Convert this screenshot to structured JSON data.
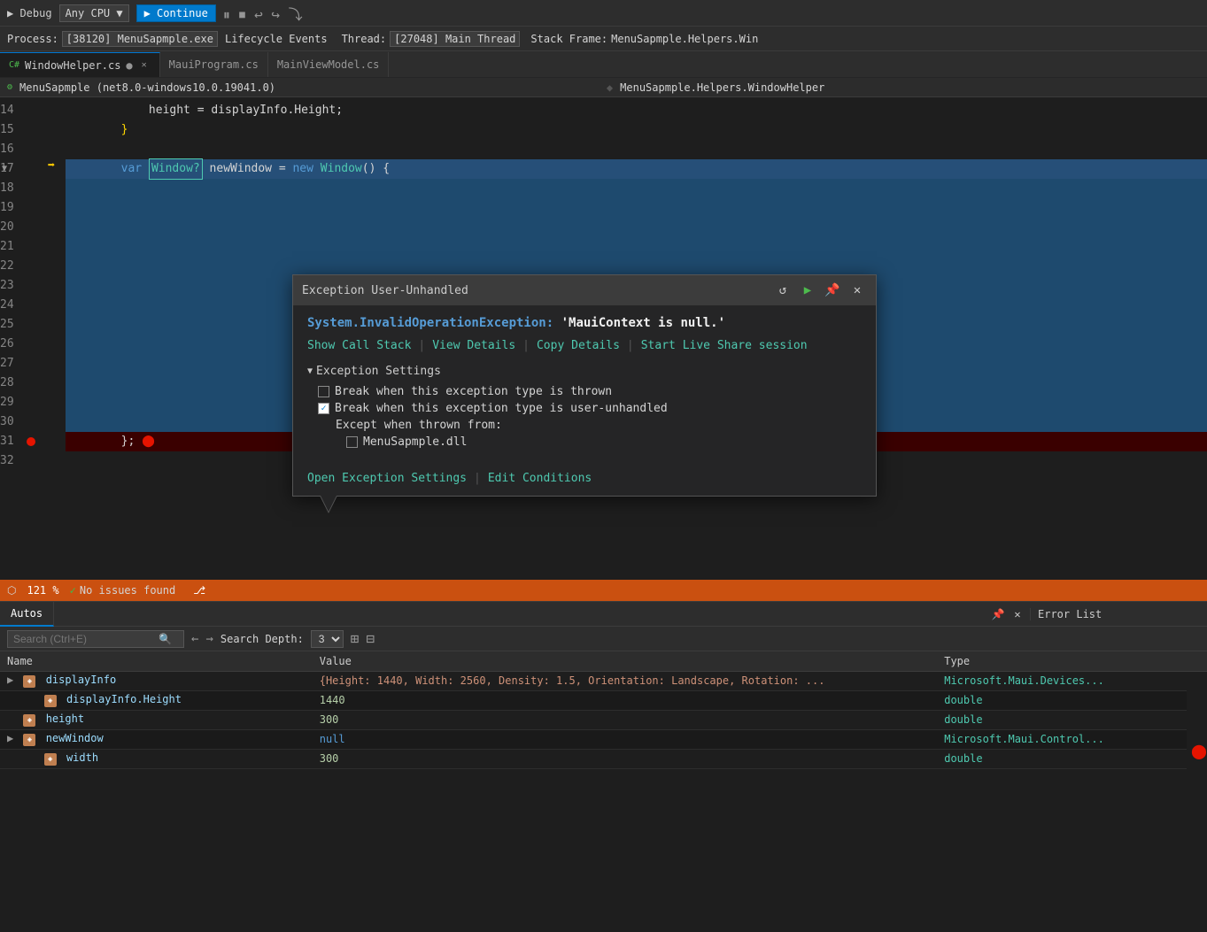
{
  "toolbar": {
    "process_label": "Process:",
    "process_value": "[38120] MenuSapmple.exe",
    "lifecycle_label": "Lifecycle Events",
    "thread_label": "Thread:",
    "thread_value": "[27048] Main Thread",
    "stackframe_label": "Stack Frame:",
    "stackframe_value": "MenuSapmple.Helpers.Win"
  },
  "tabs": [
    {
      "label": "WindowHelper.cs",
      "active": true,
      "modified": true
    },
    {
      "label": "MauiProgram.cs",
      "active": false,
      "modified": false
    },
    {
      "label": "MainViewModel.cs",
      "active": false,
      "modified": false
    }
  ],
  "navbar": {
    "namespace": "MenuSapmple (net8.0-windows10.0.19041.0)",
    "classname": "MenuSapmple.Helpers.WindowHelper"
  },
  "editor": {
    "lines": [
      {
        "num": 14,
        "code": "            height = displayInfo.Height;",
        "highlight": false
      },
      {
        "num": 15,
        "code": "        }",
        "highlight": false
      },
      {
        "num": 16,
        "code": "",
        "highlight": false
      },
      {
        "num": 17,
        "code": "        var Window? newWindow = new Window() {",
        "highlight": true
      },
      {
        "num": 18,
        "code": "",
        "highlight": false
      },
      {
        "num": 19,
        "code": "",
        "highlight": false
      },
      {
        "num": 20,
        "code": "",
        "highlight": false
      },
      {
        "num": 21,
        "code": "",
        "highlight": false
      },
      {
        "num": 22,
        "code": "",
        "highlight": false
      },
      {
        "num": 23,
        "code": "",
        "highlight": false
      },
      {
        "num": 24,
        "code": "",
        "highlight": false
      },
      {
        "num": 25,
        "code": "",
        "highlight": false
      },
      {
        "num": 26,
        "code": "",
        "highlight": false
      },
      {
        "num": 27,
        "code": "",
        "highlight": false
      },
      {
        "num": 28,
        "code": "",
        "highlight": false
      },
      {
        "num": 29,
        "code": "",
        "highlight": false
      },
      {
        "num": 30,
        "code": "",
        "highlight": false
      },
      {
        "num": 31,
        "code": "        };",
        "breakpoint": true
      },
      {
        "num": 32,
        "code": "",
        "highlight": false
      }
    ]
  },
  "exception_popup": {
    "title": "Exception User-Unhandled",
    "exception_type": "System.InvalidOperationException:",
    "exception_message": " 'MauiContext is null.'",
    "links": [
      {
        "label": "Show Call Stack"
      },
      {
        "label": "View Details"
      },
      {
        "label": "Copy Details"
      },
      {
        "label": "Start Live Share session"
      }
    ],
    "settings_section": "Exception Settings",
    "checkbox1_label": "Break when this exception type is thrown",
    "checkbox1_checked": false,
    "checkbox2_label": "Break when this exception type is user-unhandled",
    "checkbox2_checked": true,
    "except_when_label": "Except when thrown from:",
    "dll_label": "MenuSapmple.dll",
    "dll_checked": false,
    "footer_links": [
      {
        "label": "Open Exception Settings"
      },
      {
        "label": "Edit Conditions"
      }
    ]
  },
  "status_bar": {
    "zoom": "121 %",
    "issues": "No issues found"
  },
  "bottom_panel": {
    "tab_label": "Autos",
    "search_placeholder": "Search (Ctrl+E)",
    "search_depth_label": "Search Depth:",
    "search_depth_value": "3",
    "columns": [
      "Name",
      "Value",
      "Type"
    ],
    "rows": [
      {
        "indent": 0,
        "expand": true,
        "icon": "field",
        "name": "displayInfo",
        "value": "{Height: 1440, Width: 2560, Density: 1.5, Orientation: Landscape, Rotation: ...",
        "type": "Microsoft.Maui.Devices..."
      },
      {
        "indent": 1,
        "expand": false,
        "icon": "field",
        "name": "displayInfo.Height",
        "value": "1440",
        "type": "double"
      },
      {
        "indent": 1,
        "expand": false,
        "icon": "field",
        "name": "height",
        "value": "300",
        "type": "double"
      },
      {
        "indent": 0,
        "expand": true,
        "icon": "field",
        "name": "newWindow",
        "value": "null",
        "type": "Microsoft.Maui.Control..."
      },
      {
        "indent": 1,
        "expand": false,
        "icon": "field",
        "name": "width",
        "value": "300",
        "type": "double"
      }
    ]
  },
  "right_panel": {
    "title": "Error List"
  }
}
